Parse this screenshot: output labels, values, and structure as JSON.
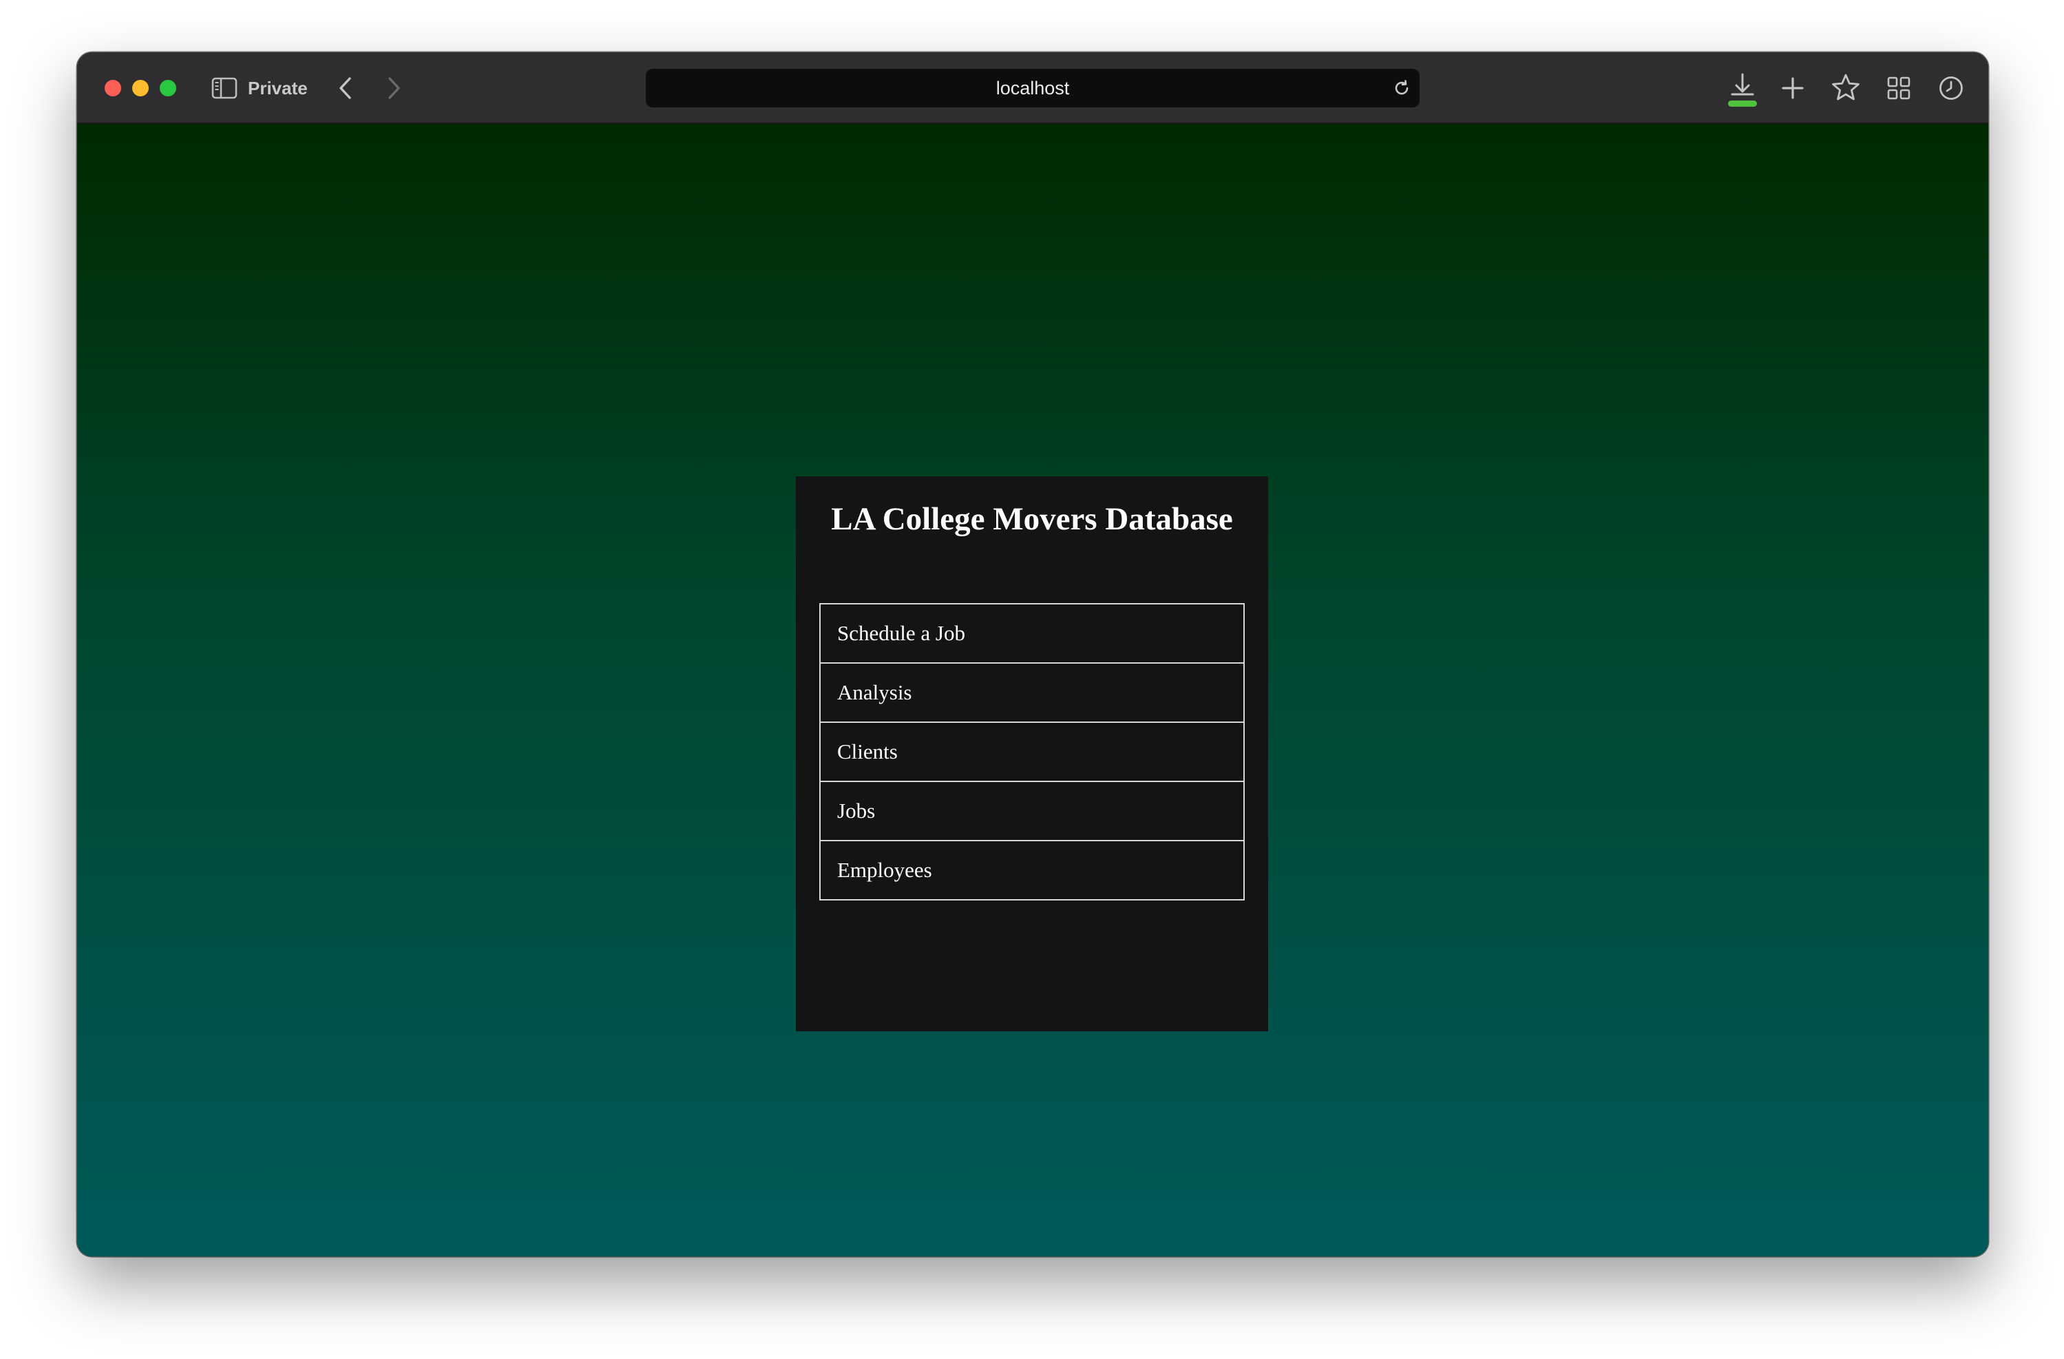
{
  "browser": {
    "mode_label": "Private",
    "address": "localhost",
    "download_progress": 1.0,
    "colors": {
      "download_accent": "#4fc13c",
      "traffic_close": "#fe5f57",
      "traffic_minimize": "#febc2e",
      "traffic_maximize": "#28c840"
    },
    "icons": [
      "sidebar-icon",
      "chevron-left-icon",
      "chevron-right-icon",
      "reload-icon",
      "download-icon",
      "plus-icon",
      "star-icon",
      "grid-icon",
      "clock-icon"
    ]
  },
  "page": {
    "background_gradient": [
      "#002a00",
      "#004730",
      "#005a5a"
    ],
    "title": "LA College Movers Database",
    "menu": [
      {
        "label": "Schedule a Job"
      },
      {
        "label": "Analysis"
      },
      {
        "label": "Clients"
      },
      {
        "label": "Jobs"
      },
      {
        "label": "Employees"
      }
    ]
  }
}
